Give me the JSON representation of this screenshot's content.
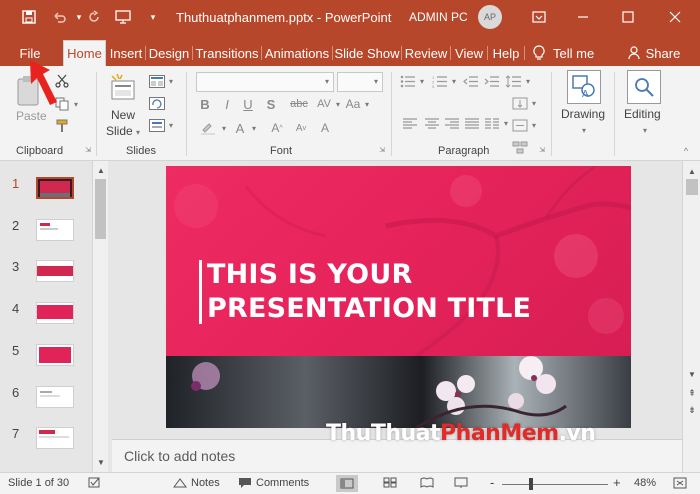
{
  "app": {
    "document_title": "Thuthuatphanmem.pptx  -  PowerPoint",
    "user_name": "ADMIN PC",
    "user_initials": "AP",
    "accent_color": "#b7472a"
  },
  "tabs": [
    {
      "label": "File"
    },
    {
      "label": "Home"
    },
    {
      "label": "Insert"
    },
    {
      "label": "Design"
    },
    {
      "label": "Transitions"
    },
    {
      "label": "Animations"
    },
    {
      "label": "Slide Show"
    },
    {
      "label": "Review"
    },
    {
      "label": "View"
    },
    {
      "label": "Help"
    },
    {
      "label": "Tell me"
    },
    {
      "label": "Share"
    }
  ],
  "ribbon": {
    "clipboard": {
      "paste_label": "Paste",
      "group_label": "Clipboard"
    },
    "slides": {
      "new_slide_label_1": "New",
      "new_slide_label_2": "Slide",
      "group_label": "Slides"
    },
    "font": {
      "group_label": "Font"
    },
    "paragraph": {
      "group_label": "Paragraph"
    },
    "drawing": {
      "label": "Drawing"
    },
    "editing": {
      "label": "Editing"
    }
  },
  "thumbnails": [
    "1",
    "2",
    "3",
    "4",
    "5",
    "6",
    "7"
  ],
  "slide": {
    "title_line1": "THIS IS YOUR",
    "title_line2": "PRESENTATION TITLE"
  },
  "notes": {
    "placeholder": "Click to add notes"
  },
  "status": {
    "slide_info": "Slide 1 of 30",
    "notes_label": "Notes",
    "comments_label": "Comments",
    "zoom_minus": "-",
    "zoom_plus": "+",
    "zoom_level": "48%"
  },
  "watermark": {
    "part1": "ThuThuat",
    "part2": "PhanMem",
    "part3": ".vn"
  }
}
